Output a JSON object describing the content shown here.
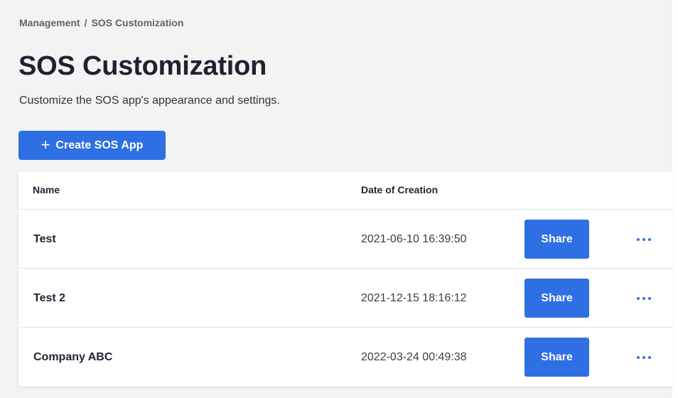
{
  "breadcrumb": {
    "parent": "Management",
    "separator": "/",
    "current": "SOS Customization"
  },
  "page": {
    "title": "SOS Customization",
    "subtitle": "Customize the SOS app's appearance and settings."
  },
  "create_button": {
    "icon": "plus-icon",
    "icon_glyph": "+",
    "label": "Create SOS App"
  },
  "table": {
    "headers": {
      "name": "Name",
      "date": "Date of Creation"
    },
    "rows": [
      {
        "name": "Test",
        "date": "2021-06-10 16:39:50",
        "share_label": "Share"
      },
      {
        "name": "Test 2",
        "date": "2021-12-15 18:16:12",
        "share_label": "Share"
      },
      {
        "name": "Company ABC",
        "date": "2022-03-24 00:49:38",
        "share_label": "Share"
      }
    ]
  },
  "colors": {
    "accent": "#2f6fe4",
    "background": "#f3f3f3",
    "card": "#ffffff"
  }
}
